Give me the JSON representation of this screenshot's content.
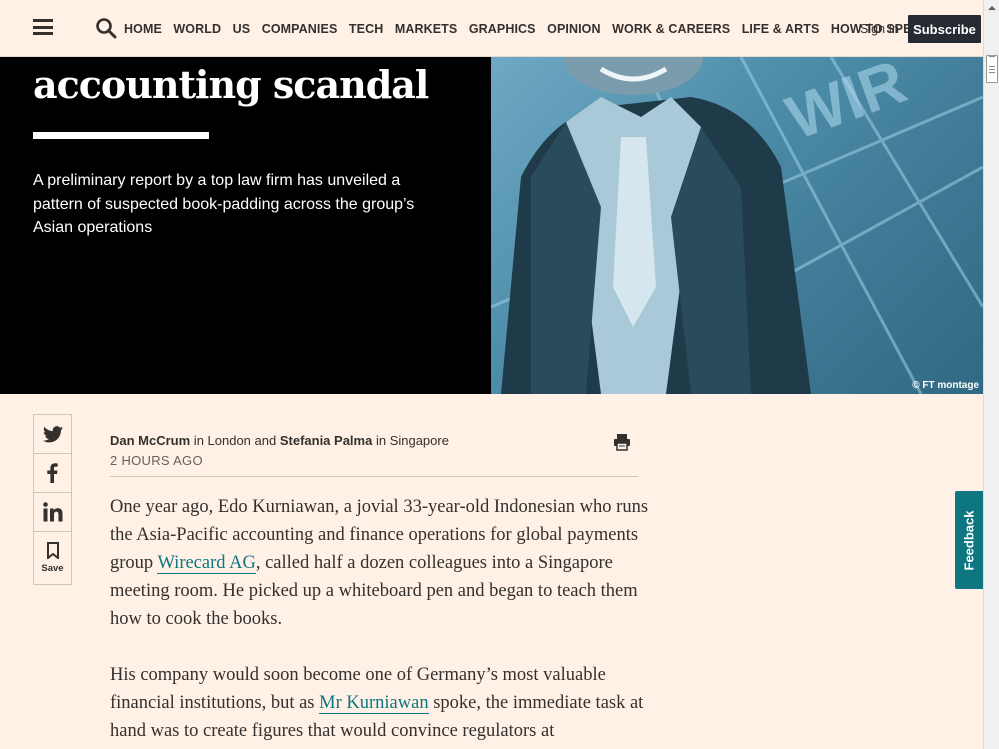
{
  "header": {
    "nav": [
      "HOME",
      "WORLD",
      "US",
      "COMPANIES",
      "TECH",
      "MARKETS",
      "GRAPHICS",
      "OPINION",
      "WORK & CAREERS",
      "LIFE & ARTS",
      "HOW TO SPEND IT"
    ],
    "sign_in": "Sign In",
    "subscribe": "Subscribe"
  },
  "hero": {
    "title": "accounting scandal",
    "standfirst": "A preliminary report by a top law firm has unveiled a pattern of suspected book-padding across the group’s Asian operations",
    "image_credit": "© FT montage"
  },
  "share": {
    "save_label": "Save"
  },
  "byline": {
    "author1": "Dan McCrum",
    "in1": " in ",
    "loc1": "London",
    "and": " and ",
    "author2": "Stefania Palma",
    "in2": " in ",
    "loc2": "Singapore",
    "time": "2 HOURS AGO"
  },
  "article": {
    "p1_a": "One year ago, Edo Kurniawan, a jovial 33-year-old Indonesian who runs the Asia-Pacific accounting and finance operations for global payments group ",
    "p1_link": "Wirecard AG",
    "p1_b": ", called half a dozen colleagues into a Singapore meeting room. He picked up a whiteboard pen and began to teach them how to cook the books.",
    "p2_a": "His company would soon become one of Germany’s most valuable financial institutions, but as ",
    "p2_link": "Mr Kurniawan",
    "p2_b": " spoke, the immediate task at hand was to create figures that would convince regulators at"
  },
  "feedback": "Feedback"
}
